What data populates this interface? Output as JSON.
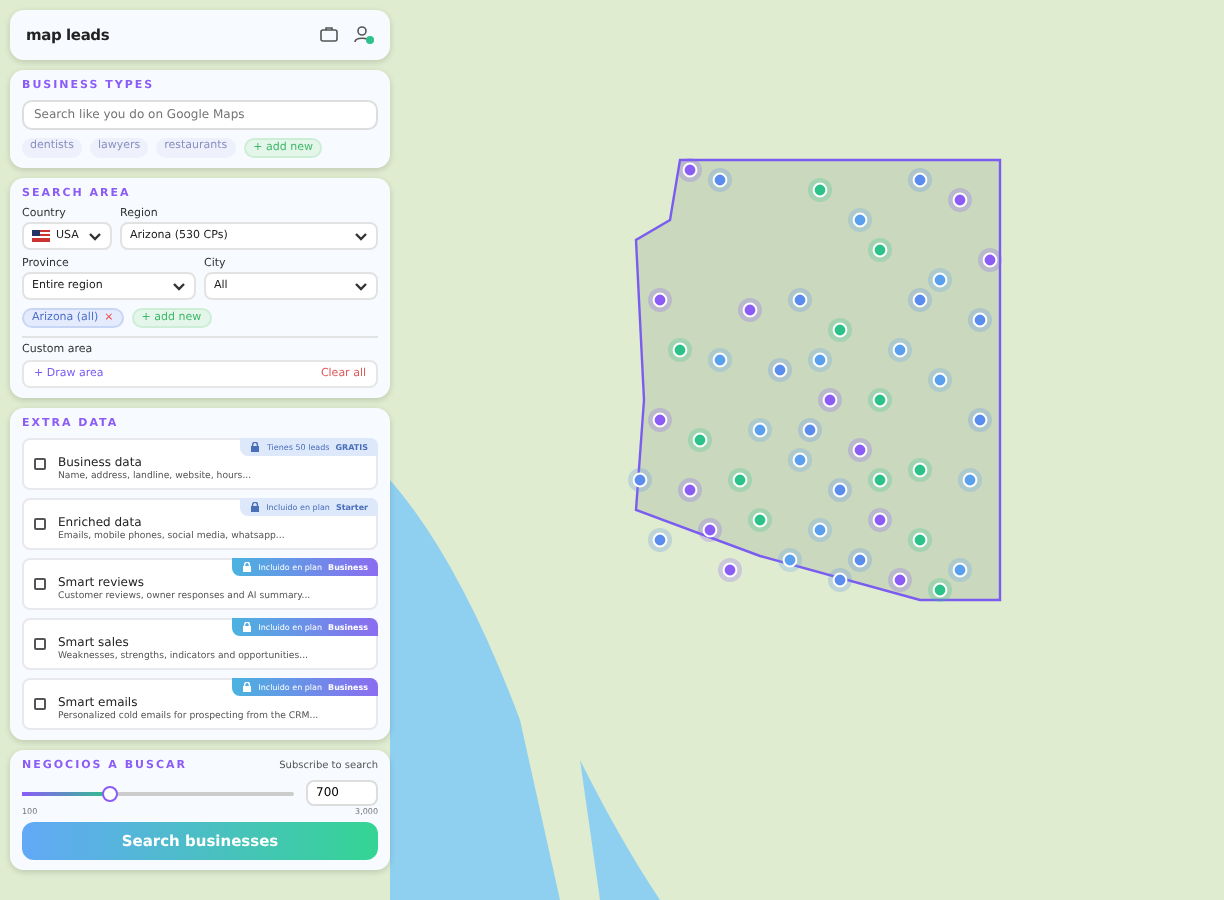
{
  "header": {
    "logo": "map leads"
  },
  "business_types": {
    "title": "BUSINESS TYPES",
    "search": {
      "placeholder": "Search like you do on Google Maps"
    },
    "suggestions": [
      "dentists",
      "lawyers",
      "restaurants"
    ],
    "add_label": "+ add new"
  },
  "search_area": {
    "title": "SEARCH AREA",
    "fields": [
      {
        "label": "Country",
        "value": "USA",
        "kind": "country"
      },
      {
        "label": "Region",
        "value": "Arizona (530 CPs)",
        "kind": "select"
      },
      {
        "label": "Province",
        "value": "Entire region",
        "kind": "select"
      },
      {
        "label": "City",
        "value": "All",
        "kind": "select"
      }
    ],
    "areas": [
      {
        "label": "Arizona (all)",
        "remove": "×"
      }
    ],
    "add_label": "+ add new",
    "custom_area": {
      "label": "Custom area",
      "draw": "+ Draw area",
      "clear": "Clear all"
    }
  },
  "extra_data": {
    "title": "EXTRA DATA",
    "items": [
      {
        "name": "Business data",
        "description": "Name, address, landline, website, hours...",
        "checked": false,
        "kind": "basic",
        "badge": "Tienes 50 leads",
        "plan": "GRATIS"
      },
      {
        "name": "Enriched data",
        "description": "Emails, mobile phones, social media, whatsapp...",
        "checked": false,
        "kind": "basic",
        "badge": "Incluido en plan",
        "plan": "Starter"
      },
      {
        "name": "Smart reviews",
        "description": "Customer reviews, owner responses and AI summary...",
        "checked": false,
        "kind": "premium",
        "badge": "Incluido en plan",
        "plan": "Business"
      },
      {
        "name": "Smart sales",
        "description": "Weaknesses, strengths, indicators and opportunities...",
        "checked": false,
        "kind": "premium",
        "badge": "Incluido en plan",
        "plan": "Business"
      },
      {
        "name": "Smart emails",
        "description": "Personalized cold emails for prospecting from the CRM...",
        "checked": false,
        "kind": "premium",
        "badge": "Incluido en plan",
        "plan": "Business"
      }
    ]
  },
  "search_count": {
    "title": "NEGOCIOS A BUSCAR",
    "subscribe": "Subscribe to search",
    "slider": {
      "level": 0.32,
      "min_label": "100",
      "max_label": "3,000"
    },
    "value": "700",
    "button": "Search businesses"
  }
}
